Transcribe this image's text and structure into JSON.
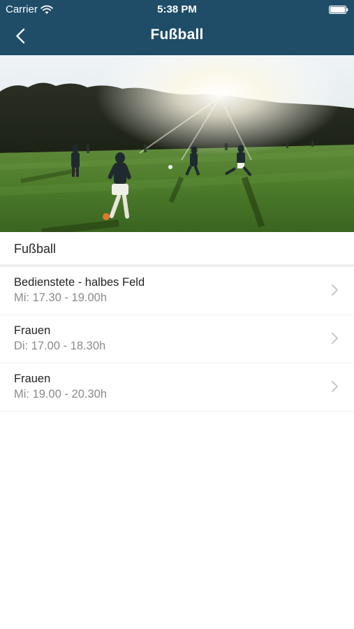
{
  "status_bar": {
    "carrier": "Carrier",
    "time": "5:38 PM",
    "wifi_icon": "wifi-icon",
    "battery_icon": "battery-full-icon"
  },
  "nav": {
    "title": "Fußball",
    "back_icon": "chevron-left-icon"
  },
  "hero": {
    "description": "photo"
  },
  "section": {
    "title": "Fußball"
  },
  "items": [
    {
      "title": "Bedienstete - halbes Feld",
      "subtitle": "Mi: 17.30 - 19.00h"
    },
    {
      "title": "Frauen",
      "subtitle": "Di: 17.00 - 18.30h"
    },
    {
      "title": "Frauen",
      "subtitle": "Mi: 19.00 - 20.30h"
    }
  ],
  "colors": {
    "nav_background": "#1f4d68",
    "nav_text": "#ffffff",
    "subtitle_text": "#8a8a8a",
    "chevron": "#c7c7cc"
  }
}
